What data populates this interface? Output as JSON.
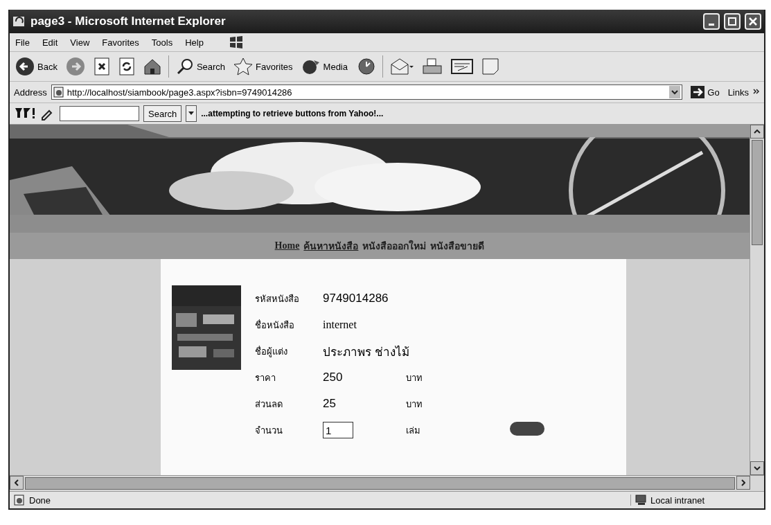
{
  "window": {
    "title": "page3 - Microsoft Internet Explorer"
  },
  "menu": [
    "File",
    "Edit",
    "View",
    "Favorites",
    "Tools",
    "Help"
  ],
  "toolbar": [
    {
      "kind": "back",
      "label": "Back"
    },
    {
      "kind": "forward"
    },
    {
      "kind": "stop"
    },
    {
      "kind": "refresh"
    },
    {
      "kind": "home"
    },
    {
      "kind": "search",
      "label": "Search"
    },
    {
      "kind": "favorites",
      "label": "Favorites"
    },
    {
      "kind": "media",
      "label": "Media"
    },
    {
      "kind": "history"
    },
    {
      "kind": "mail"
    },
    {
      "kind": "print"
    },
    {
      "kind": "edit"
    },
    {
      "kind": "note"
    }
  ],
  "address": {
    "label": "Address",
    "url": "http://localhost/siambook/page3.aspx?isbn=9749014286",
    "go": "Go",
    "links": "Links"
  },
  "yahoo_bar": {
    "search_button": "Search",
    "message": "...attempting to retrieve buttons from Yahoo!..."
  },
  "nav": [
    {
      "label": "Home",
      "kind": "link"
    },
    {
      "label": "ค้นหาหนังสือ",
      "kind": "link"
    },
    {
      "label": "หนังสือออกใหม่",
      "kind": "text"
    },
    {
      "label": "หนังสือขายดี",
      "kind": "text"
    }
  ],
  "book": {
    "fields": [
      {
        "label": "รหัสหนังสือ",
        "value": "9749014286"
      },
      {
        "label": "ชื่อหนังสือ",
        "value": "internet"
      },
      {
        "label": "ชื่อผู้แต่ง",
        "value": "ประภาพร ช่างไม้"
      },
      {
        "label": "ราคา",
        "value": "250",
        "unit": "บาท"
      },
      {
        "label": "ส่วนลด",
        "value": "25",
        "unit": "บาท"
      }
    ],
    "quantity": {
      "label": "จำนวน",
      "value": "1",
      "unit": "เล่ม"
    }
  },
  "status_bar": {
    "text": "Done",
    "zone": "Local intranet"
  }
}
